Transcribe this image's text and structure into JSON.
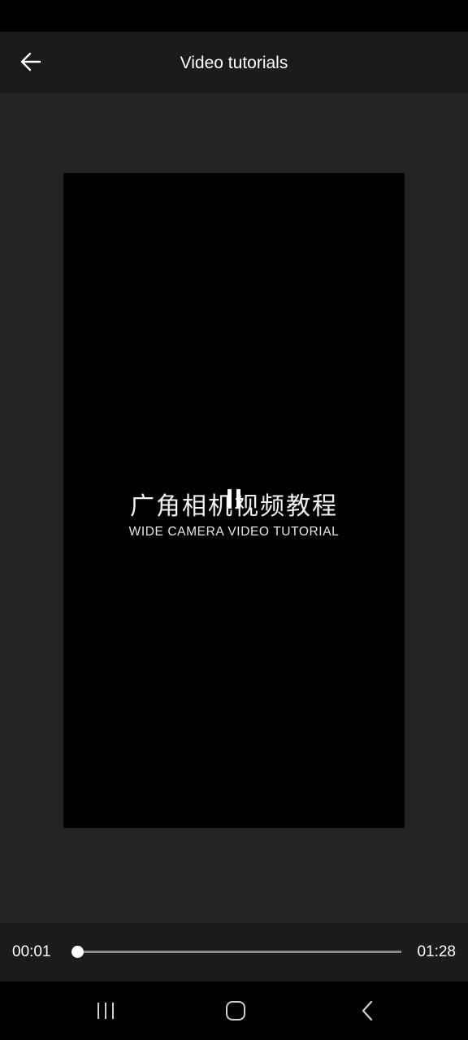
{
  "header": {
    "title": "Video tutorials",
    "back_icon": "arrow-left-icon"
  },
  "video": {
    "overlay_text_cn": "广角相机视频教程",
    "overlay_text_en": "WIDE CAMERA VIDEO TUTORIAL",
    "state": "playing",
    "pause_icon": "pause-icon"
  },
  "player": {
    "current_time": "00:01",
    "total_time": "01:28",
    "progress": 0.011
  },
  "nav": {
    "recents_icon": "recents-icon",
    "home_icon": "home-icon",
    "back_icon": "back-chevron-icon"
  },
  "colors": {
    "background": "#242424",
    "bar": "#1b1b1b",
    "video": "#000000",
    "track": "#8a8a8a"
  }
}
